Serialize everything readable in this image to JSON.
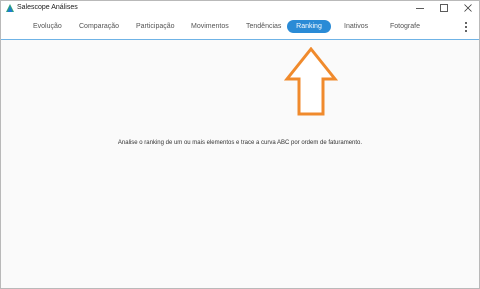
{
  "window": {
    "title": "Salescope Análises",
    "icon": "salescope-logo-icon",
    "controls": [
      "minimize-icon",
      "maximize-icon",
      "close-icon"
    ]
  },
  "nav": {
    "tabs": [
      {
        "label": "Evolução",
        "active": false
      },
      {
        "label": "Comparação",
        "active": false
      },
      {
        "label": "Participação",
        "active": false
      },
      {
        "label": "Movimentos",
        "active": false
      },
      {
        "label": "Tendências",
        "active": false
      },
      {
        "label": "Ranking",
        "active": true
      },
      {
        "label": "Inativos",
        "active": false
      },
      {
        "label": "Fotografe",
        "active": false
      }
    ],
    "more_icon": "vertical-dots-icon"
  },
  "colors": {
    "accent": "#2a8bd6",
    "arrow": "#f08a2c"
  },
  "content": {
    "message": "Analise o ranking de um ou mais elementos e trace a curva ABC por ordem de faturamento."
  }
}
